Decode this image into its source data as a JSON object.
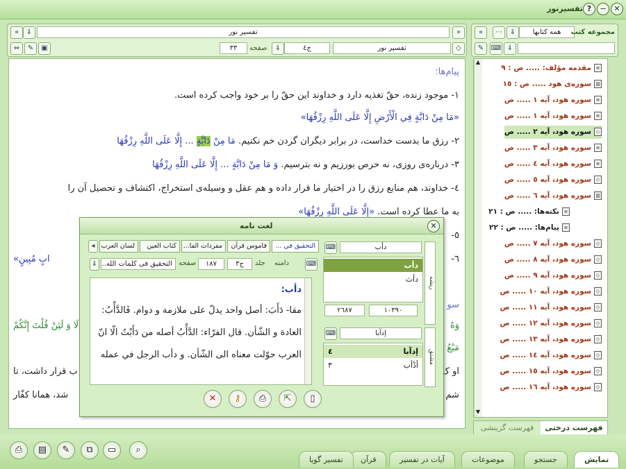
{
  "window": {
    "title": "تفسیرنور"
  },
  "left_panel": {
    "doc_title": "تفسیر نور",
    "book_field": "تفسیر نور",
    "volume": "ج٤",
    "page_label": "صفحه",
    "page_value": "٣٣"
  },
  "doc": {
    "heading": "پیام‌ها:",
    "l1": "١- موجود زنده، حقّ تغذیه دارد و خداوند این حقّ را بر خود واجب کرده است.",
    "l2": "«مَا مِنْ دَابَّةٍ فِي الْأَرْضِ إِلَّا عَلَى اللَّهِ رِزْقُهَا»",
    "l3a": "٢- رزق ما بدست خداست، در برابر دیگران گردن خم نکنیم. ",
    "l3b": "مَا مِنْ ",
    "l3c": "دَابَّةٍ",
    "l3d": " ... إِلَّا عَلَى اللَّهِ رِزْقُهَا",
    "l4a": "٣- درباره‌ی روزی، نه حرص بورزیم و نه بترسیم. ",
    "l4b": "وَ مَا مِنْ دَابَّةٍ ... إِلَّا عَلَى اللَّهِ رِزْقُهَا",
    "l5": "٤- خداوند، هم منابع رزق را در اختیار ما قرار داده و هم عقل و وسیله‌ی استخراج، اکتشاف و تحصیل آن را",
    "l6a": "به ما عطا کرده است. ",
    "l6b": "«إِلَّا عَلَى اللَّهِ رِزْقُهَا»",
    "l7": "٥-",
    "l8": "٦-",
    "l8r": "ابٍ مُبِينٍ»",
    "l9": "سو",
    "l10": "وَهُ",
    "l10r": "لَا وَ لَئِنْ قُلْتَ إِنَّكُمْ",
    "l11": "مَبْعُ",
    "l12": "او ک",
    "l12r": "ب قرار داشت، تا",
    "l13": "شم",
    "l13r": "شد، همانا کفّار"
  },
  "right_panel": {
    "title": "مجموعه کتب",
    "books_select": "همه کتابها",
    "items": [
      {
        "label": "مقدمه مؤلف: ..... ص : ٩",
        "icon": "page-icon"
      },
      {
        "label": "سوره‌ی هود ..... ص : ١٥",
        "icon": "book-icon"
      },
      {
        "label": "سوره هود، آیه ١ ..... ص",
        "icon": "page-icon"
      },
      {
        "label": "سوره هود، آیه ١ ..... ص",
        "icon": "page-icon"
      },
      {
        "label": "سوره هود، آیه ٢ ..... ص",
        "icon": "cube-icon"
      },
      {
        "label": "سوره هود، آیه ٣ ..... ص",
        "icon": "page-icon"
      },
      {
        "label": "سوره هود، آیه ٤ ..... ص",
        "icon": "page-icon"
      },
      {
        "label": "سوره هود، آیه ٥ ..... ص",
        "icon": "cube-icon"
      },
      {
        "label": "سوره هود، آیه ٦ ..... ص",
        "icon": "book-icon"
      },
      {
        "label": "نکته‌ها: ..... ص : ٢١",
        "icon": "page-icon"
      },
      {
        "label": "پیام‌ها: ..... ص : ٢٢",
        "icon": "page-icon"
      },
      {
        "label": "سوره هود، آیه ٧ ..... ص",
        "icon": "cube-icon"
      },
      {
        "label": "سوره هود، آیه ٨ ..... ص",
        "icon": "cube-icon"
      },
      {
        "label": "سوره هود، آیه ٩ ..... ص",
        "icon": "cube-icon"
      },
      {
        "label": "سوره هود، آیه ١٠ ..... ص",
        "icon": "cube-icon"
      },
      {
        "label": "سوره هود، آیه ١١ ..... ص",
        "icon": "cube-icon"
      },
      {
        "label": "سوره هود، آیه ١٢ ..... ص",
        "icon": "cube-icon"
      },
      {
        "label": "سوره هود، آیه ١٣ ..... ص",
        "icon": "cube-icon"
      },
      {
        "label": "سوره هود، آیه ١٤ ..... ص",
        "icon": "cube-icon"
      },
      {
        "label": "سوره هود، آیه ١٥ ..... ص",
        "icon": "cube-icon"
      },
      {
        "label": "سوره هود، آیه ١٦ ..... ص",
        "icon": "cube-icon"
      }
    ],
    "tab_tree": "فهرست درختی",
    "tab_history": "فهرست گزینشی"
  },
  "bottom_tabs": [
    "نمایش",
    "جستجو",
    "موضوعات",
    "آیات در تفسیر",
    "قرآن",
    "تفسیر گویا"
  ],
  "dialog": {
    "title": "لغت نامه",
    "tabs": [
      "التحقیق في ...",
      "قاموس قرآن",
      "مفردات الفا...",
      "کتاب العین",
      "لسان العرب"
    ],
    "book_field": "التحقیق فی کلمات الله...",
    "page_label": "صفحه",
    "page_value": "١٨٧",
    "volume_label": "جلد",
    "volume_value": "ج٣",
    "range_label": "دامنه",
    "text_heading": "دأب:",
    "t1": "مقا- دَأَبَ: أصل واحد يدلّ على ملازمة و دوام. فَالدَّأْبُ:",
    "t2": "العادة و الشّأن. قال الفرّاء: الدَّأْبُ أصله من دَأَبْتُ الّا انّ",
    "t3": "العرب حوّلت معناه الى الشّأن. و دأب الرجل في عمله",
    "root_search": "دأب",
    "root_tab": "ریشه",
    "roots": [
      "دأب",
      "دأث"
    ],
    "count_a": "١٠٣٩٠",
    "count_b": "٢٦٨٧",
    "deriv_tab": "مشتق",
    "deriv_search": "إدآبا",
    "derivs": [
      {
        "w": "إدآبا",
        "n": "٤"
      },
      {
        "w": "أدْأب",
        "n": "٣"
      }
    ]
  }
}
